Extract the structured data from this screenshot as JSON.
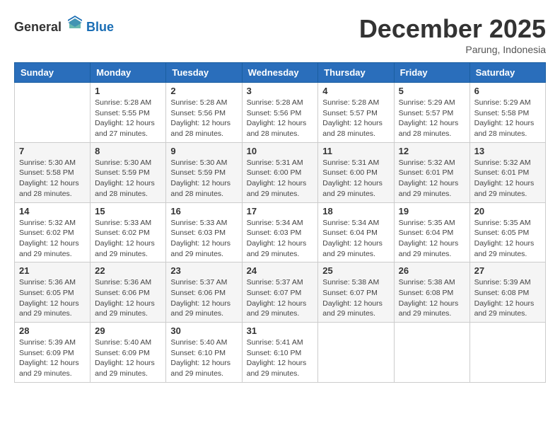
{
  "header": {
    "logo_general": "General",
    "logo_blue": "Blue",
    "month_year": "December 2025",
    "location": "Parung, Indonesia"
  },
  "days_of_week": [
    "Sunday",
    "Monday",
    "Tuesday",
    "Wednesday",
    "Thursday",
    "Friday",
    "Saturday"
  ],
  "weeks": [
    [
      {
        "day": "",
        "sunrise": "",
        "sunset": "",
        "daylight": ""
      },
      {
        "day": "1",
        "sunrise": "5:28 AM",
        "sunset": "5:55 PM",
        "daylight": "12 hours and 27 minutes."
      },
      {
        "day": "2",
        "sunrise": "5:28 AM",
        "sunset": "5:56 PM",
        "daylight": "12 hours and 28 minutes."
      },
      {
        "day": "3",
        "sunrise": "5:28 AM",
        "sunset": "5:56 PM",
        "daylight": "12 hours and 28 minutes."
      },
      {
        "day": "4",
        "sunrise": "5:28 AM",
        "sunset": "5:57 PM",
        "daylight": "12 hours and 28 minutes."
      },
      {
        "day": "5",
        "sunrise": "5:29 AM",
        "sunset": "5:57 PM",
        "daylight": "12 hours and 28 minutes."
      },
      {
        "day": "6",
        "sunrise": "5:29 AM",
        "sunset": "5:58 PM",
        "daylight": "12 hours and 28 minutes."
      }
    ],
    [
      {
        "day": "7",
        "sunrise": "5:30 AM",
        "sunset": "5:58 PM",
        "daylight": "12 hours and 28 minutes."
      },
      {
        "day": "8",
        "sunrise": "5:30 AM",
        "sunset": "5:59 PM",
        "daylight": "12 hours and 28 minutes."
      },
      {
        "day": "9",
        "sunrise": "5:30 AM",
        "sunset": "5:59 PM",
        "daylight": "12 hours and 28 minutes."
      },
      {
        "day": "10",
        "sunrise": "5:31 AM",
        "sunset": "6:00 PM",
        "daylight": "12 hours and 29 minutes."
      },
      {
        "day": "11",
        "sunrise": "5:31 AM",
        "sunset": "6:00 PM",
        "daylight": "12 hours and 29 minutes."
      },
      {
        "day": "12",
        "sunrise": "5:32 AM",
        "sunset": "6:01 PM",
        "daylight": "12 hours and 29 minutes."
      },
      {
        "day": "13",
        "sunrise": "5:32 AM",
        "sunset": "6:01 PM",
        "daylight": "12 hours and 29 minutes."
      }
    ],
    [
      {
        "day": "14",
        "sunrise": "5:32 AM",
        "sunset": "6:02 PM",
        "daylight": "12 hours and 29 minutes."
      },
      {
        "day": "15",
        "sunrise": "5:33 AM",
        "sunset": "6:02 PM",
        "daylight": "12 hours and 29 minutes."
      },
      {
        "day": "16",
        "sunrise": "5:33 AM",
        "sunset": "6:03 PM",
        "daylight": "12 hours and 29 minutes."
      },
      {
        "day": "17",
        "sunrise": "5:34 AM",
        "sunset": "6:03 PM",
        "daylight": "12 hours and 29 minutes."
      },
      {
        "day": "18",
        "sunrise": "5:34 AM",
        "sunset": "6:04 PM",
        "daylight": "12 hours and 29 minutes."
      },
      {
        "day": "19",
        "sunrise": "5:35 AM",
        "sunset": "6:04 PM",
        "daylight": "12 hours and 29 minutes."
      },
      {
        "day": "20",
        "sunrise": "5:35 AM",
        "sunset": "6:05 PM",
        "daylight": "12 hours and 29 minutes."
      }
    ],
    [
      {
        "day": "21",
        "sunrise": "5:36 AM",
        "sunset": "6:05 PM",
        "daylight": "12 hours and 29 minutes."
      },
      {
        "day": "22",
        "sunrise": "5:36 AM",
        "sunset": "6:06 PM",
        "daylight": "12 hours and 29 minutes."
      },
      {
        "day": "23",
        "sunrise": "5:37 AM",
        "sunset": "6:06 PM",
        "daylight": "12 hours and 29 minutes."
      },
      {
        "day": "24",
        "sunrise": "5:37 AM",
        "sunset": "6:07 PM",
        "daylight": "12 hours and 29 minutes."
      },
      {
        "day": "25",
        "sunrise": "5:38 AM",
        "sunset": "6:07 PM",
        "daylight": "12 hours and 29 minutes."
      },
      {
        "day": "26",
        "sunrise": "5:38 AM",
        "sunset": "6:08 PM",
        "daylight": "12 hours and 29 minutes."
      },
      {
        "day": "27",
        "sunrise": "5:39 AM",
        "sunset": "6:08 PM",
        "daylight": "12 hours and 29 minutes."
      }
    ],
    [
      {
        "day": "28",
        "sunrise": "5:39 AM",
        "sunset": "6:09 PM",
        "daylight": "12 hours and 29 minutes."
      },
      {
        "day": "29",
        "sunrise": "5:40 AM",
        "sunset": "6:09 PM",
        "daylight": "12 hours and 29 minutes."
      },
      {
        "day": "30",
        "sunrise": "5:40 AM",
        "sunset": "6:10 PM",
        "daylight": "12 hours and 29 minutes."
      },
      {
        "day": "31",
        "sunrise": "5:41 AM",
        "sunset": "6:10 PM",
        "daylight": "12 hours and 29 minutes."
      },
      {
        "day": "",
        "sunrise": "",
        "sunset": "",
        "daylight": ""
      },
      {
        "day": "",
        "sunrise": "",
        "sunset": "",
        "daylight": ""
      },
      {
        "day": "",
        "sunrise": "",
        "sunset": "",
        "daylight": ""
      }
    ]
  ]
}
